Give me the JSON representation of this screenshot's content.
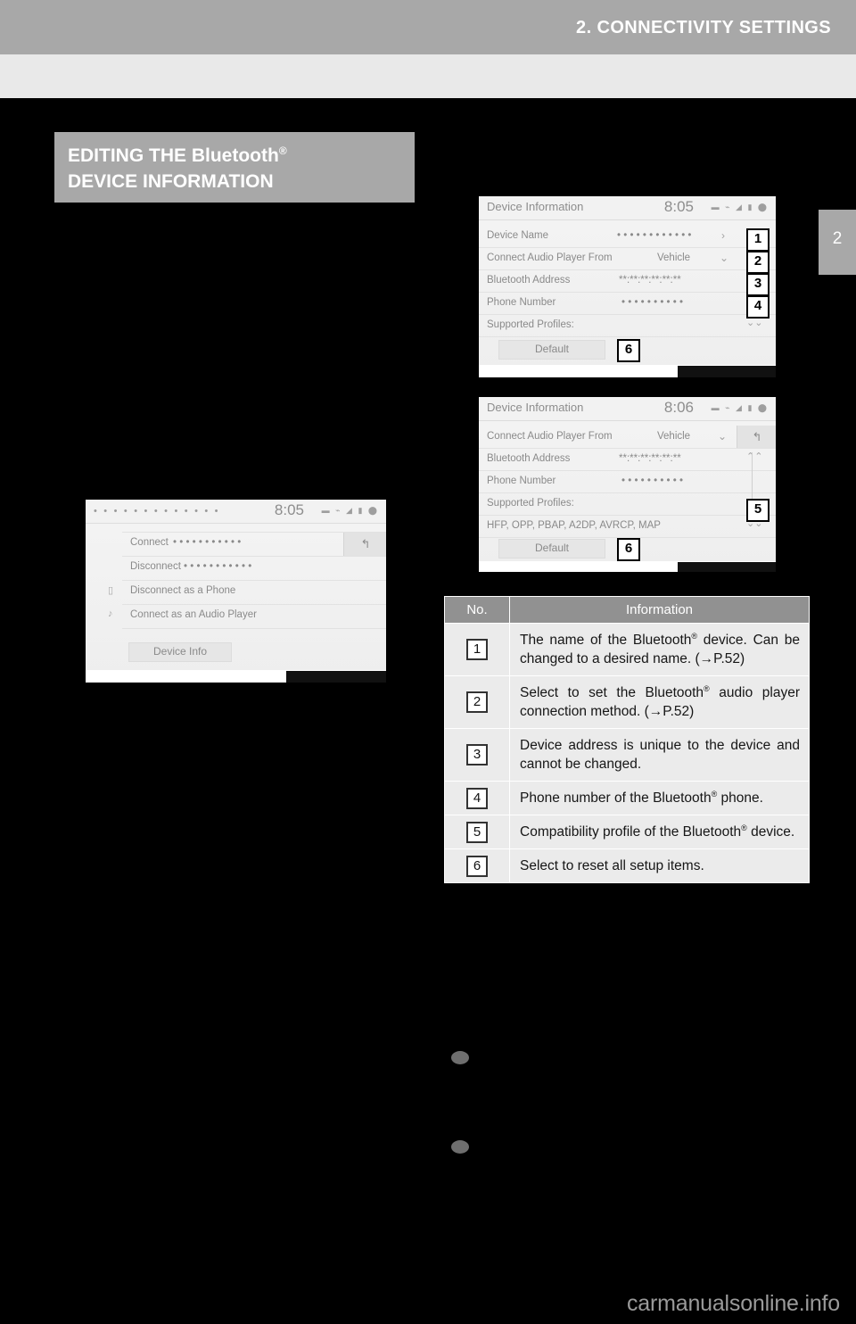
{
  "header": {
    "chapter_title": "2. CONNECTIVITY SETTINGS",
    "chapter_tab_number": "2"
  },
  "footer": {
    "url": "carmanualsonline.info"
  },
  "section": {
    "heading_line1": "EDITING THE Bluetooth",
    "heading_line1_sup": "®",
    "heading_line2": "DEVICE INFORMATION"
  },
  "screenshots": {
    "device_menu": {
      "title_dots": "• • • • • • • • • • • • •",
      "clock": "8:05",
      "system_icons": "▬ ⌁ ◢ ▮ ⬤",
      "rows": [
        {
          "label": "Connect",
          "value": "• • • • • • • • • • •",
          "lead_icon": ""
        },
        {
          "label": "Disconnect",
          "value": "• • • • • • • • • • •",
          "lead_icon": ""
        },
        {
          "label": "Disconnect as a Phone",
          "value": "",
          "lead_icon": "phone-icon"
        },
        {
          "label": "Connect as an Audio Player",
          "value": "",
          "lead_icon": "music-note-icon"
        }
      ],
      "back_button": "↰",
      "device_info_button": "Device Info"
    },
    "device_information_1": {
      "title": "Device Information",
      "clock": "8:05",
      "system_icons": "▬ ⌁ ◢ ▮ ⬤",
      "rows": [
        {
          "label": "Device Name",
          "value": "• • • • • • • • • • • •",
          "chevron": "›",
          "callout": "1"
        },
        {
          "label": "Connect Audio Player From",
          "value": "Vehicle",
          "chevron": "⌄",
          "callout": "2"
        },
        {
          "label": "Bluetooth Address",
          "value": "**:**:**:**:**:**",
          "chevron": "",
          "callout": "3"
        },
        {
          "label": "Phone Number",
          "value": "• • • • • • • • • •",
          "chevron": "",
          "callout": "4"
        },
        {
          "label": "Supported Profiles:",
          "value": "",
          "chevron": "⌄⌄",
          "callout": ""
        }
      ],
      "default_button": "Default",
      "default_callout": "6"
    },
    "device_information_2": {
      "title": "Device Information",
      "clock": "8:06",
      "system_icons": "▬ ⌁ ◢ ▮ ⬤",
      "rows": [
        {
          "label": "Connect Audio Player From",
          "value": "Vehicle",
          "chevron": "⌄",
          "callout": ""
        },
        {
          "label": "Bluetooth Address",
          "value": "**:**:**:**:**:**",
          "chevron": "⌃⌃",
          "callout": ""
        },
        {
          "label": "Phone Number",
          "value": "• • • • • • • • • •",
          "chevron": "",
          "callout": ""
        },
        {
          "label": "Supported Profiles:",
          "value": "",
          "chevron": "",
          "callout": ""
        },
        {
          "label": "HFP,        OPP, PBAP, A2DP, AVRCP, MAP",
          "value": "",
          "chevron": "⌄⌄",
          "callout": ""
        }
      ],
      "back_button": "↰",
      "scroll_callout": "5",
      "default_button": "Default",
      "default_callout": "6"
    }
  },
  "info_table": {
    "columns": [
      "No.",
      "Information"
    ],
    "rows": [
      {
        "no": "1",
        "text_parts": [
          "The name of the Bluetooth",
          "®",
          " device. Can be changed to a desired name. (→P.52)"
        ]
      },
      {
        "no": "2",
        "text_parts": [
          "Select to set the Bluetooth",
          "®",
          " audio player connection method. (→P.52)"
        ]
      },
      {
        "no": "3",
        "text_parts": [
          "Device address is unique to the device and cannot be changed.",
          "",
          ""
        ]
      },
      {
        "no": "4",
        "text_parts": [
          "Phone number of the Bluetooth",
          "®",
          " phone."
        ]
      },
      {
        "no": "5",
        "text_parts": [
          "Compatibility profile of the Bluetooth",
          "®",
          " device."
        ]
      },
      {
        "no": "6",
        "text_parts": [
          "Select to reset all setup items.",
          "",
          ""
        ]
      }
    ]
  },
  "notes": {
    "bullet_1": "",
    "bullet_2": ""
  }
}
